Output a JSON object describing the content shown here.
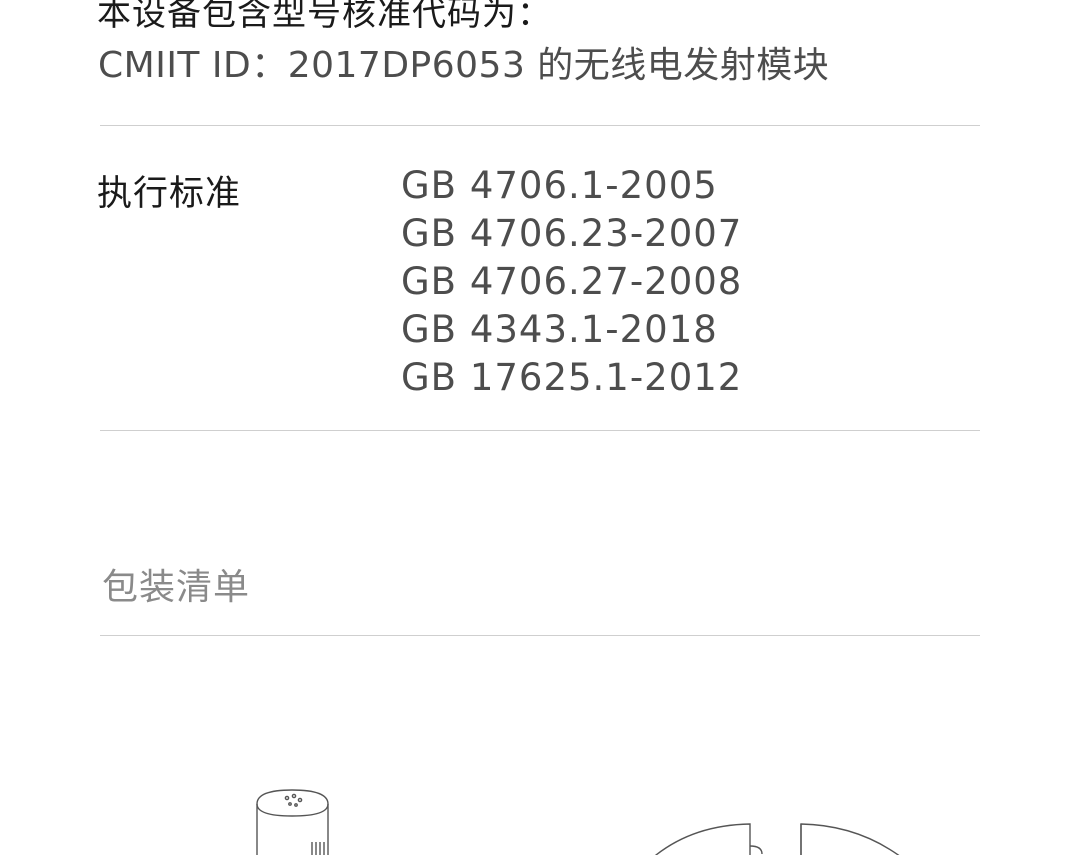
{
  "spec": {
    "radio_intro": "本设备包含型号核准代码为：",
    "cmiit_line": "CMIIT ID：2017DP6053 的无线电发射模块",
    "standards_label": "执行标准",
    "standards": [
      "GB 4706.1-2005",
      "GB 4706.23-2007",
      "GB 4706.27-2008",
      "GB 4343.1-2018",
      "GB 17625.1-2012"
    ]
  },
  "packing": {
    "heading": "包装清单",
    "items": [
      {
        "icon": "heater-unit-icon"
      },
      {
        "icon": "heater-base-icon"
      }
    ]
  },
  "colors": {
    "text_dark": "#1a1a1a",
    "text_mid": "#4d4d4d",
    "text_light": "#8a8a8a",
    "divider": "#cfcfcf",
    "line_art": "#555555"
  }
}
